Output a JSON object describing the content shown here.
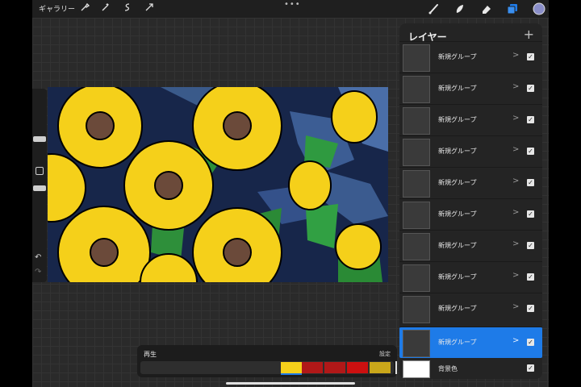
{
  "toolbar": {
    "gallery_label": "ギャラリー",
    "more_glyph": "•••"
  },
  "colors": {
    "accent": "#1e7be8",
    "canvas_bg": "#17264a",
    "sunflower_petal": "#f5d01a",
    "current_color": "#8a8ec8"
  },
  "icons": {
    "actions": "wrench-icon",
    "adjustments": "magic-wand-icon",
    "selection": "selection-icon",
    "transform": "transform-arrow-icon",
    "brush": "brush-icon",
    "smudge": "smudge-icon",
    "eraser": "eraser-icon",
    "layers": "layers-icon",
    "color": "color-swatch-icon"
  },
  "layers_panel": {
    "title": "レイヤー",
    "add_label": "+",
    "layers": [
      {
        "name": "新規グループ",
        "visible": true
      },
      {
        "name": "新規グループ",
        "visible": true
      },
      {
        "name": "新規グループ",
        "visible": true
      },
      {
        "name": "新規グループ",
        "visible": true
      },
      {
        "name": "新規グループ",
        "visible": true
      },
      {
        "name": "新規グループ",
        "visible": true
      },
      {
        "name": "新規グループ",
        "visible": true
      },
      {
        "name": "新規グループ",
        "visible": true
      },
      {
        "name": "新規グループ",
        "visible": true
      },
      {
        "name": "新規グループ",
        "visible": true,
        "selected": true
      }
    ],
    "background_label": "背景色"
  },
  "animation": {
    "play_label": "再生",
    "settings_label": "設定"
  },
  "sidebar": {
    "undo_glyph": "↶",
    "redo_glyph": "↷"
  }
}
